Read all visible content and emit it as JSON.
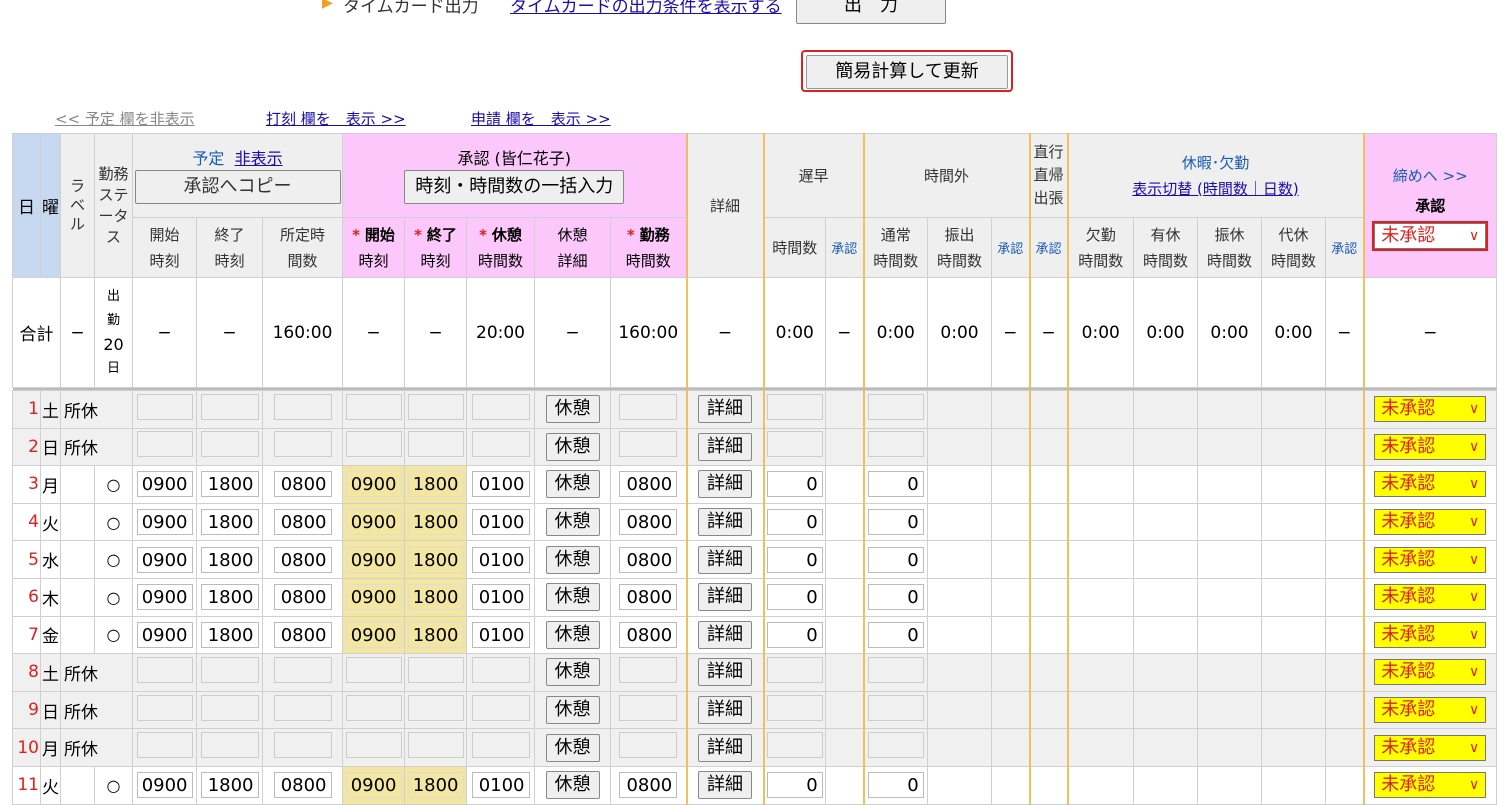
{
  "top": {
    "timecard_label": "タイムカード出力",
    "timecard_link": "タイムカードの出力条件を表示する",
    "output_button": "出　力",
    "calc_button": "簡易計算して更新"
  },
  "toggles": {
    "yotei_hide": "<< 予定 欄を非表示",
    "dakoku_show": "打刻 欄を　表示 >>",
    "shinsei_show": "申請 欄を　表示 >>"
  },
  "header": {
    "day": "日",
    "weekday": "曜",
    "label": "ラベル",
    "status": "勤務ステータス",
    "yotei": "予定",
    "yotei_hide_link": "非表示",
    "copy_button": "承認へコピー",
    "start": "開始時刻",
    "end": "終了時刻",
    "scheduled": "所定時間数",
    "approval_title": "承認 (皆仁花子)",
    "bulk_button": "時刻・時間数の一括入力",
    "a_start": "開始",
    "a_start2": "時刻",
    "a_end": "終了",
    "a_end2": "時刻",
    "a_break": "休憩",
    "a_break2": "時間数",
    "a_breakdetail": "休憩",
    "a_breakdetail2": "詳細",
    "a_work": "勤務",
    "a_work2": "時間数",
    "asterisk": "*",
    "detail": "詳細",
    "late": "遅早",
    "late_hours": "時間数",
    "approve": "承認",
    "overtime": "時間外",
    "normal": "通常",
    "normal2": "時間数",
    "furide": "振出",
    "furide2": "時間数",
    "direct": "直行直帰出張",
    "leave": "休暇･欠勤",
    "leave_toggle": "表示切替 (時間数｜日数)",
    "absent": "欠勤",
    "paid": "有休",
    "subst": "振休",
    "comp": "代休",
    "hours": "時間数",
    "close_link": "締めへ >>",
    "close_approve": "承認",
    "close_select": "未承認"
  },
  "summary": {
    "label": "合計",
    "dash": "−",
    "status_1": "出",
    "status_2": "勤",
    "status_3": "20",
    "status_4": "日",
    "scheduled": "160:00",
    "break": "20:00",
    "work": "160:00",
    "zero": "0:00"
  },
  "row_labels": {
    "break_button": "休憩",
    "detail_button": "詳細",
    "approval_select": "未承認"
  },
  "rows": [
    {
      "day": "1",
      "wd": "土",
      "label": "所休",
      "holiday": true
    },
    {
      "day": "2",
      "wd": "日",
      "label": "所休",
      "holiday": true
    },
    {
      "day": "3",
      "wd": "月",
      "status": "○",
      "start": "0900",
      "end": "1800",
      "sched": "0800",
      "a_start": "0900",
      "a_end": "1800",
      "a_break": "0100",
      "a_work": "0800",
      "late": "0",
      "normal": "0"
    },
    {
      "day": "4",
      "wd": "火",
      "status": "○",
      "start": "0900",
      "end": "1800",
      "sched": "0800",
      "a_start": "0900",
      "a_end": "1800",
      "a_break": "0100",
      "a_work": "0800",
      "late": "0",
      "normal": "0"
    },
    {
      "day": "5",
      "wd": "水",
      "status": "○",
      "start": "0900",
      "end": "1800",
      "sched": "0800",
      "a_start": "0900",
      "a_end": "1800",
      "a_break": "0100",
      "a_work": "0800",
      "late": "0",
      "normal": "0"
    },
    {
      "day": "6",
      "wd": "木",
      "status": "○",
      "start": "0900",
      "end": "1800",
      "sched": "0800",
      "a_start": "0900",
      "a_end": "1800",
      "a_break": "0100",
      "a_work": "0800",
      "late": "0",
      "normal": "0"
    },
    {
      "day": "7",
      "wd": "金",
      "status": "○",
      "start": "0900",
      "end": "1800",
      "sched": "0800",
      "a_start": "0900",
      "a_end": "1800",
      "a_break": "0100",
      "a_work": "0800",
      "late": "0",
      "normal": "0"
    },
    {
      "day": "8",
      "wd": "土",
      "label": "所休",
      "holiday": true
    },
    {
      "day": "9",
      "wd": "日",
      "label": "所休",
      "holiday": true
    },
    {
      "day": "10",
      "wd": "月",
      "label": "所休",
      "holiday": true
    },
    {
      "day": "11",
      "wd": "火",
      "status": "○",
      "start": "0900",
      "end": "1800",
      "sched": "0800",
      "a_start": "0900",
      "a_end": "1800",
      "a_break": "0100",
      "a_work": "0800",
      "late": "0",
      "normal": "0"
    }
  ],
  "colors": {
    "approval_header": "#fcc8fc",
    "approved_time": "#f2e6a0",
    "select_bg": "#ffff00",
    "accent_red": "#e02020",
    "day_col": "#c6d9f1"
  }
}
